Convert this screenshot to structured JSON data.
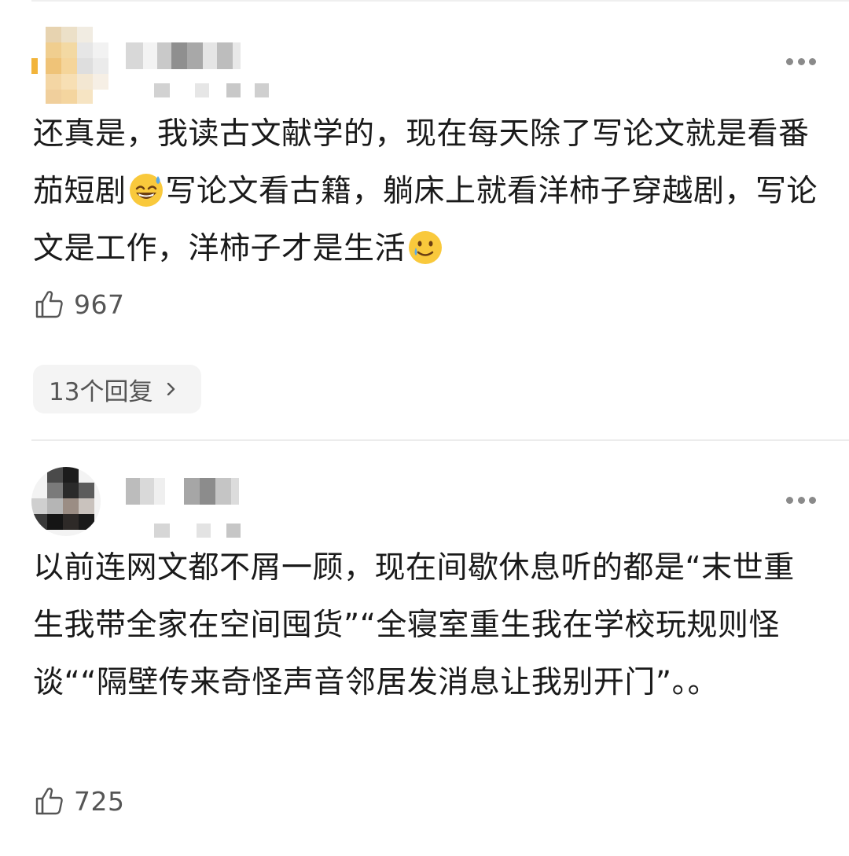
{
  "comments": [
    {
      "text_parts": [
        "还真是，我读古文献学的，现在每天除了写论文就是看番茄短剧",
        "写论文看古籍，躺床上就看洋柿子穿越剧，写论文是工作，洋柿子才是生活"
      ],
      "emojis": [
        "grinning-sweat-emoji",
        "smiling-tear-emoji"
      ],
      "likes": "967",
      "replies_label": "13个回复"
    },
    {
      "text": "以前连网文都不屑一顾，现在间歇休息听的都是“末世重生我带全家在空间囤货”“全寝室重生我在学校玩规则怪谈““隔壁传来奇怪声音邻居发消息让我别开门”。。",
      "likes": "725"
    }
  ],
  "icons": {
    "more": "more-dots-icon",
    "like": "thumbs-up-icon",
    "chevron": "chevron-right-icon"
  },
  "colors": {
    "text": "#1a1a1a",
    "secondary": "#555555",
    "reply_bg": "#f4f4f4",
    "divider": "#ececec"
  }
}
